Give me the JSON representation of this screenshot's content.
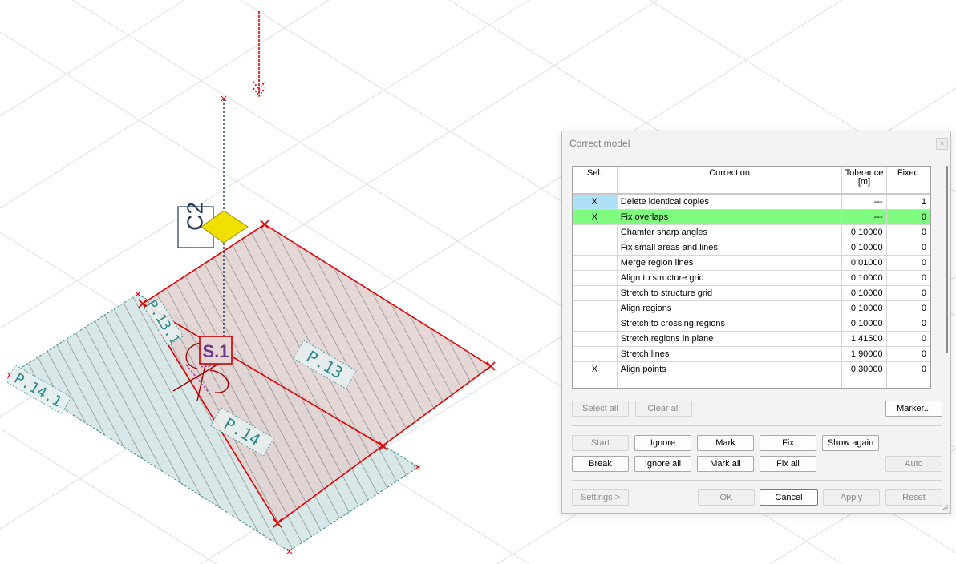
{
  "viewport": {
    "labels": {
      "c2": "C2",
      "s1": "S.1",
      "p13": "P.13",
      "p13_1": "P.13.1",
      "p14": "P.14",
      "p14_1": "P.14.1"
    },
    "colors": {
      "region_red": "#e00000",
      "slab_fill": "#d4e4e4",
      "slab_edge": "#3a8c8c",
      "region_fill": "#e2d0d0",
      "hatch": "#8a8a8a",
      "grid_line": "#dedede",
      "column_marker": "#f0e000",
      "column_axis": "#1f3a5a",
      "label_teal": "#2d8a8a",
      "label_purple": "#6a3a8a"
    }
  },
  "dialog": {
    "title": "Correct model",
    "close_label": "×",
    "columns": {
      "sel": "Sel.",
      "correction": "Correction",
      "tolerance": "Tolerance [m]",
      "fixed": "Fixed"
    },
    "rows": [
      {
        "sel": "X",
        "name": "Delete identical copies",
        "tolerance": "---",
        "fixed": "1"
      },
      {
        "sel": "X",
        "name": "Fix overlaps",
        "tolerance": "---",
        "fixed": "0"
      },
      {
        "sel": "",
        "name": "Chamfer sharp angles",
        "tolerance": "0.10000",
        "fixed": "0"
      },
      {
        "sel": "",
        "name": "Fix small areas and lines",
        "tolerance": "0.10000",
        "fixed": "0"
      },
      {
        "sel": "",
        "name": "Merge region lines",
        "tolerance": "0.01000",
        "fixed": "0"
      },
      {
        "sel": "",
        "name": "Align to structure grid",
        "tolerance": "0.10000",
        "fixed": "0"
      },
      {
        "sel": "",
        "name": "Stretch to structure grid",
        "tolerance": "0.10000",
        "fixed": "0"
      },
      {
        "sel": "",
        "name": "Align regions",
        "tolerance": "0.10000",
        "fixed": "0"
      },
      {
        "sel": "",
        "name": "Stretch to crossing regions",
        "tolerance": "0.10000",
        "fixed": "0"
      },
      {
        "sel": "",
        "name": "Stretch regions in plane",
        "tolerance": "1.41500",
        "fixed": "0"
      },
      {
        "sel": "",
        "name": "Stretch lines",
        "tolerance": "1.90000",
        "fixed": "0"
      },
      {
        "sel": "X",
        "name": "Align points",
        "tolerance": "0.30000",
        "fixed": "0"
      }
    ],
    "buttons": {
      "select_all": "Select all",
      "clear_all": "Clear all",
      "marker": "Marker...",
      "start": "Start",
      "ignore": "Ignore",
      "mark": "Mark",
      "fix": "Fix",
      "show_again": "Show again",
      "break": "Break",
      "ignore_all": "Ignore all",
      "mark_all": "Mark all",
      "fix_all": "Fix all",
      "auto": "Auto",
      "settings": "Settings >",
      "ok": "OK",
      "cancel": "Cancel",
      "apply": "Apply",
      "reset": "Reset"
    }
  }
}
